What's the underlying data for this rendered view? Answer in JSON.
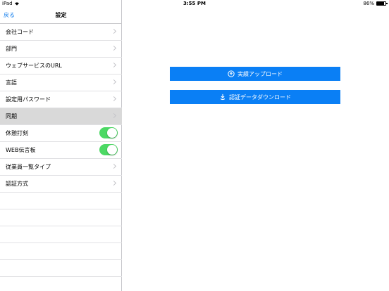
{
  "status_bar": {
    "device": "iPad",
    "time": "3:55 PM",
    "battery": "86%",
    "battery_level": 0.86
  },
  "sidebar": {
    "back_label": "戻る",
    "title": "設定",
    "items": [
      {
        "label": "会社コード",
        "type": "chevron"
      },
      {
        "label": "部門",
        "type": "chevron"
      },
      {
        "label": "ウェブサービスのURL",
        "type": "chevron"
      },
      {
        "label": "言語",
        "type": "chevron"
      },
      {
        "label": "設定用パスワード",
        "type": "chevron"
      },
      {
        "label": "同期",
        "type": "chevron",
        "selected": true
      },
      {
        "label": "休憩打刻",
        "type": "toggle",
        "on": true
      },
      {
        "label": "WEB伝言板",
        "type": "toggle",
        "on": true
      },
      {
        "label": "従業員一覧タイプ",
        "type": "chevron"
      },
      {
        "label": "認証方式",
        "type": "chevron"
      }
    ]
  },
  "main": {
    "upload_button": "実績アップロード",
    "download_button": "認証データダウンロード"
  },
  "colors": {
    "accent": "#0a7ff5",
    "toggle_on": "#4cd964",
    "selected_row": "#d9d9d9"
  }
}
